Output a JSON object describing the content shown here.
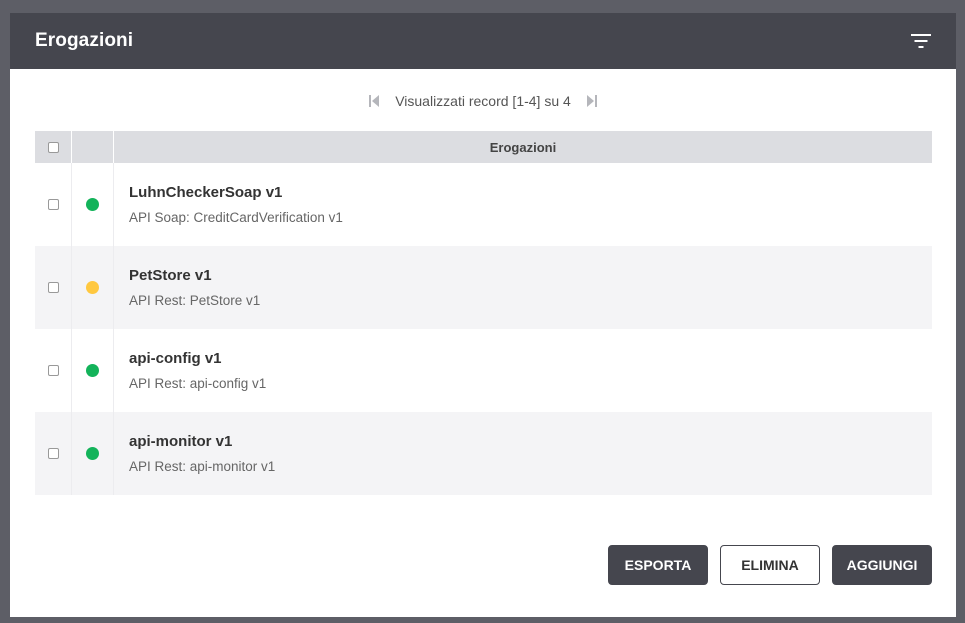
{
  "header": {
    "title": "Erogazioni",
    "filter_icon": "filter-icon"
  },
  "pager": {
    "text": "Visualizzati record [1-4] su 4"
  },
  "table": {
    "column_header": "Erogazioni",
    "rows": [
      {
        "title": "LuhnCheckerSoap v1",
        "subtitle": "API Soap: CreditCardVerification v1",
        "status_color": "#13b35a"
      },
      {
        "title": "PetStore v1",
        "subtitle": "API Rest: PetStore v1",
        "status_color": "#ffc840"
      },
      {
        "title": "api-config v1",
        "subtitle": "API Rest: api-config v1",
        "status_color": "#13b35a"
      },
      {
        "title": "api-monitor v1",
        "subtitle": "API Rest: api-monitor v1",
        "status_color": "#13b35a"
      }
    ]
  },
  "actions": {
    "export": "ESPORTA",
    "delete": "ELIMINA",
    "add": "AGGIUNGI"
  },
  "colors": {
    "header_bg": "#45464e",
    "status_ok": "#13b35a",
    "status_warn": "#ffc840"
  }
}
